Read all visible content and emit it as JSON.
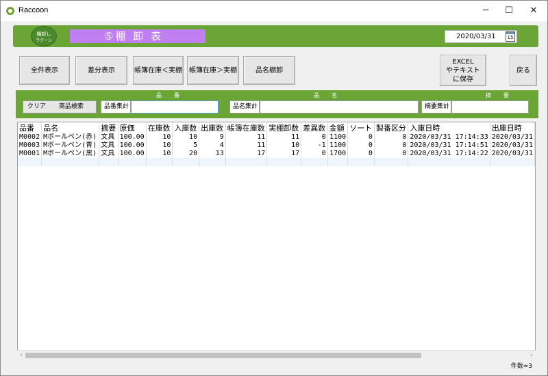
{
  "window": {
    "title": "Raccoon",
    "min_glyph": "─",
    "max_glyph": "☐",
    "close_glyph": "✕"
  },
  "header": {
    "logo_line1": "棚卸し",
    "logo_line2": "ラクーン",
    "banner": "⑤棚 卸 表",
    "date": "2020/03/31",
    "calendar_day": "15"
  },
  "buttons": {
    "all": "全件表示",
    "diff": "差分表示",
    "book_lt_actual": "帳簿在庫＜実棚",
    "book_gt_actual": "帳簿在庫＞実棚",
    "name_stock": "品名棚卸",
    "excel": "EXCEL\nやテキスト\nに保存",
    "back": "戻る"
  },
  "filters": {
    "head_code": "品番",
    "head_name": "品名",
    "head_summary": "摘要",
    "clear": "クリア",
    "product_search": "商品検索",
    "code_total": "品番集計",
    "name_total": "品名集計",
    "summary_total": "摘要集計",
    "code_value": "",
    "name_value": "",
    "summary_value": ""
  },
  "table": {
    "columns": [
      "品番",
      "品名",
      "摘要",
      "原価",
      "在庫数",
      "入庫数",
      "出庫数",
      "帳簿在庫数",
      "実棚卸数",
      "差異数",
      "金額",
      "ソート",
      "製番区分",
      "入庫日時",
      "出庫日時"
    ],
    "rows": [
      [
        "M0002",
        "Mボールペン(赤)",
        "文具",
        "100.00",
        "10",
        "10",
        "9",
        "11",
        "11",
        "0",
        "1100",
        "0",
        "0",
        "2020/03/31  17:14:33",
        "2020/03/31"
      ],
      [
        "M0003",
        "Mボールペン(青)",
        "文具",
        "100.00",
        "10",
        "5",
        "4",
        "11",
        "10",
        "-1",
        "1100",
        "0",
        "0",
        "2020/03/31  17:14:51",
        "2020/03/31"
      ],
      [
        "M0001",
        "Mボールペン(黒)",
        "文具",
        "100.00",
        "10",
        "20",
        "13",
        "17",
        "17",
        "0",
        "1700",
        "0",
        "0",
        "2020/03/31  17:14:22",
        "2020/03/31"
      ]
    ]
  },
  "scroll": {
    "left_arrow": "‹",
    "right_arrow": "›"
  },
  "status": {
    "count": "件数=3"
  },
  "colors": {
    "accent_green": "#6aa535",
    "banner_purple": "#c07ff0"
  }
}
